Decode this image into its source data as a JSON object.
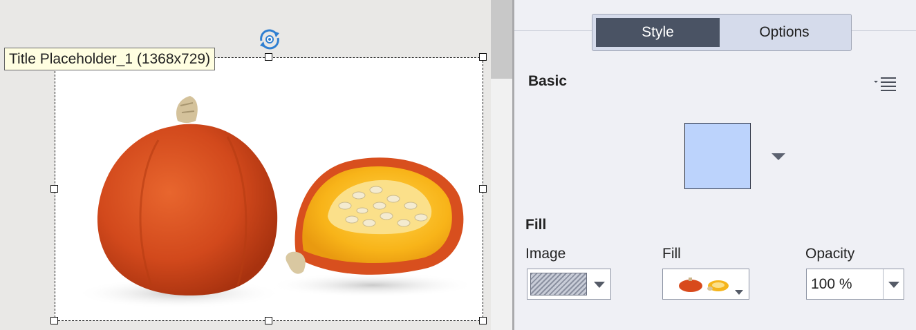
{
  "canvas": {
    "tooltip": "Title Placeholder_1 (1368x729)",
    "image_subject": "pumpkin-photo"
  },
  "panel": {
    "tabs": [
      {
        "label": "Style",
        "active": true
      },
      {
        "label": "Options",
        "active": false
      }
    ],
    "basic": {
      "title": "Basic",
      "swatch_color": "#bcd3fc"
    },
    "fill": {
      "title": "Fill",
      "image_label": "Image",
      "fill_label": "Fill",
      "opacity_label": "Opacity",
      "opacity_value": "100 %"
    }
  },
  "colors": {
    "active_tab": "#4a5364",
    "tab_bar": "#d5dbeb",
    "rotate_icon": "#2f7fd1"
  }
}
